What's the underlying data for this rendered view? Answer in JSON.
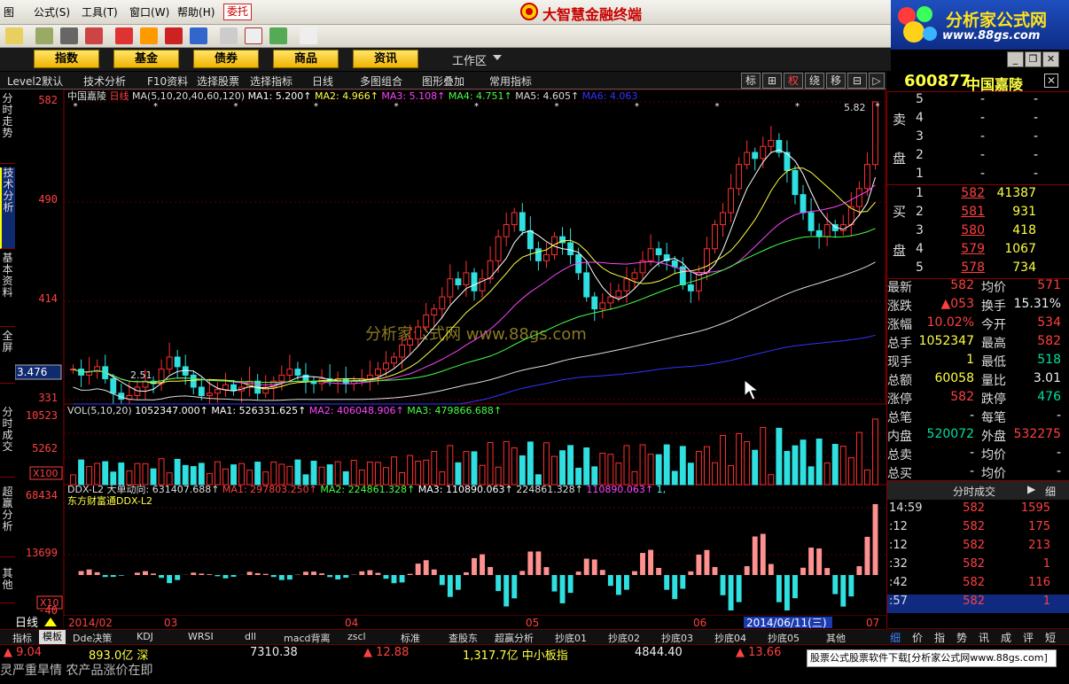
{
  "menubar": {
    "items": [
      "图",
      "公式",
      "工具",
      "窗口",
      "帮助"
    ],
    "item_keys": [
      "",
      "(S)",
      "(T)",
      "(W)",
      "(H)"
    ],
    "weituo": "委托",
    "title": "大智慧金融终端"
  },
  "brand": {
    "name": "分析家公式网",
    "url": "www.88gs.com"
  },
  "nav": {
    "buttons": [
      "指数",
      "基金",
      "债券",
      "商品",
      "资讯"
    ],
    "workarea": "工作区"
  },
  "subbar": {
    "items": [
      "Level2默认",
      "技术分析",
      "F10资料",
      "选择股票",
      "选择指标",
      "日线",
      "多图组合",
      "图形叠加",
      "常用指标"
    ],
    "buttons": [
      "标",
      "⊞",
      "权",
      "绕",
      "移",
      "⊟",
      "▷"
    ]
  },
  "left_tabs": [
    "分时走势",
    "技术分析",
    "基本资料",
    "全屏",
    "分时成交",
    "超赢分析",
    "其他"
  ],
  "stock": {
    "code": "600877",
    "name": "中国嘉陵"
  },
  "chart": {
    "header": [
      {
        "t": "中国嘉陵 ",
        "c": "#ddd"
      },
      {
        "t": "日线",
        "c": "#ff4040"
      },
      {
        "t": " MA(5,10,20,40,60,120) ",
        "c": "#ddd"
      },
      {
        "t": "MA1: 5.200↑",
        "c": "#fff"
      },
      {
        "t": " MA2: 4.966↑",
        "c": "#ffff44"
      },
      {
        "t": " MA3: 5.108↑",
        "c": "#ff44ff"
      },
      {
        "t": " MA4: 4.751↑",
        "c": "#44ff44"
      },
      {
        "t": " MA5: 4.605↑",
        "c": "#ddd"
      },
      {
        "t": " MA6: 4.063",
        "c": "#3333ff"
      }
    ],
    "price_labels": [
      "582",
      "490",
      "414",
      "331"
    ],
    "cursor_value": "3.476",
    "high_label": "5.82",
    "low_label": "2.51",
    "vol_header": [
      {
        "t": "VOL(5,10,20) ",
        "c": "#ddd"
      },
      {
        "t": "1052347.000↑",
        "c": "#fff"
      },
      {
        "t": "  MA1: 526331.625↑",
        "c": "#fff"
      },
      {
        "t": "  MA2: 406048.906↑",
        "c": "#ff44ff"
      },
      {
        "t": "  MA3: 479866.688↑",
        "c": "#44ff44"
      }
    ],
    "vol_labels": [
      "10523",
      "5262"
    ],
    "vol_unit": "X100",
    "ddx_header": [
      {
        "t": "DDX-L2  大单动向: 631407.688↑",
        "c": "#ddd"
      },
      {
        "t": "  MA1: 297803.250↑",
        "c": "#ff4040"
      },
      {
        "t": "  MA2: 224861.328↑",
        "c": "#44ff44"
      },
      {
        "t": "  MA3: 110890.063↑",
        "c": "#fff"
      },
      {
        "t": "  224861.328↑",
        "c": "#ddd"
      },
      {
        "t": "  110890.063↑",
        "c": "#ff44ff"
      },
      {
        "t": "  1,",
        "c": "#44ffff"
      }
    ],
    "ddx_subtitle": "东方财富通DDX-L2",
    "ddx_labels": [
      "68434",
      "13699",
      "-40"
    ],
    "ddx_unit": "X10",
    "dates": [
      "2014/02",
      "03",
      "04",
      "05",
      "06",
      "07"
    ],
    "date_selected": "2014/06/11(三)",
    "watermark": "分析家公式网 www.88gs.com",
    "period_label": "日线"
  },
  "chart_data": {
    "type": "candlestick",
    "ylim": [
      3.31,
      5.82
    ],
    "close": [
      3.6,
      3.55,
      3.58,
      3.62,
      3.52,
      3.4,
      3.35,
      3.38,
      3.45,
      3.5,
      3.48,
      3.6,
      3.7,
      3.62,
      3.55,
      3.45,
      3.38,
      3.4,
      3.43,
      3.47,
      3.42,
      3.45,
      3.5,
      3.4,
      3.45,
      3.5,
      3.55,
      3.6,
      3.55,
      3.5,
      3.48,
      3.52,
      3.5,
      3.52,
      3.48,
      3.5,
      3.52,
      3.55,
      3.6,
      3.65,
      3.7,
      3.8,
      3.85,
      3.95,
      4.05,
      4.1,
      4.2,
      4.35,
      4.3,
      4.4,
      4.25,
      4.35,
      4.5,
      4.7,
      4.8,
      4.9,
      4.75,
      4.6,
      4.5,
      4.55,
      4.7,
      4.65,
      4.55,
      4.4,
      4.2,
      4.1,
      4.15,
      4.2,
      4.25,
      4.35,
      4.4,
      4.5,
      4.6,
      4.55,
      4.5,
      4.45,
      4.3,
      4.25,
      4.4,
      4.6,
      4.8,
      4.9,
      5.1,
      5.3,
      5.4,
      5.35,
      5.45,
      5.5,
      5.4,
      5.25,
      5.05,
      4.9,
      4.75,
      4.7,
      4.8,
      4.75,
      4.8,
      4.95,
      5.1,
      5.3,
      5.82
    ],
    "ma_names": [
      "MA1",
      "MA2",
      "MA3",
      "MA4",
      "MA5",
      "MA6"
    ],
    "ma_colors": [
      "#ffffff",
      "#ffff44",
      "#ff44ff",
      "#44ff44",
      "#dddddd",
      "#3333ff"
    ],
    "vol_max": 10523,
    "ddx_max": 68434,
    "ddx_min": -40
  },
  "quote": {
    "sell_label": "卖盘",
    "buy_label": "买盘",
    "sell": [
      [
        "5",
        "-",
        "-"
      ],
      [
        "4",
        "-",
        "-"
      ],
      [
        "3",
        "-",
        "-"
      ],
      [
        "2",
        "-",
        "-"
      ],
      [
        "1",
        "-",
        "-"
      ]
    ],
    "buy": [
      [
        "1",
        "582",
        "41387"
      ],
      [
        "2",
        "581",
        "931"
      ],
      [
        "3",
        "580",
        "418"
      ],
      [
        "4",
        "579",
        "1067"
      ],
      [
        "5",
        "578",
        "734"
      ]
    ],
    "stats": [
      [
        "最新",
        "582",
        "red",
        "均价",
        "571",
        "red"
      ],
      [
        "涨跌",
        "▲053",
        "red",
        "换手",
        "15.31%",
        "wht"
      ],
      [
        "涨幅",
        "10.02%",
        "red",
        "今开",
        "534",
        "red"
      ],
      [
        "总手",
        "1052347",
        "yel",
        "最高",
        "582",
        "red"
      ],
      [
        "现手",
        "1",
        "yel",
        "最低",
        "518",
        "grn"
      ],
      [
        "总额",
        "60058",
        "yel",
        "量比",
        "3.01",
        "wht"
      ],
      [
        "涨停",
        "582",
        "red",
        "跌停",
        "476",
        "grn"
      ],
      [
        "总笔",
        "-",
        "wht",
        "每笔",
        "-",
        "wht"
      ],
      [
        "内盘",
        "520072",
        "grn",
        "外盘",
        "532275",
        "red"
      ],
      [
        "总卖",
        "-",
        "wht",
        "均价",
        "-",
        "wht"
      ],
      [
        "总买",
        "-",
        "wht",
        "均价",
        "-",
        "wht"
      ]
    ],
    "ticks_title": "分时成交",
    "ticks_btn": "细",
    "ticks": [
      [
        "14:59",
        "582",
        "1595"
      ],
      [
        ":12",
        "582",
        "175"
      ],
      [
        ":12",
        "582",
        "213"
      ],
      [
        ":32",
        "582",
        "1"
      ],
      [
        ":42",
        "582",
        "116"
      ],
      [
        ":57",
        "582",
        "1"
      ]
    ]
  },
  "bottom_tabs": [
    "指标",
    "模板",
    "Dde决策",
    "KDJ",
    "WRSI",
    "dll",
    "macd背离",
    "zscl",
    "标准",
    "查股东",
    "超赢分析",
    "抄底01",
    "抄底02",
    "抄底03",
    "抄底04",
    "抄底05",
    "其他"
  ],
  "right_tabs": [
    "细",
    "价",
    "指",
    "势",
    "讯",
    "成",
    "评",
    "短"
  ],
  "ticker": [
    [
      "▲ 9.04",
      "red"
    ],
    [
      "893.0亿 深",
      "yel"
    ],
    [
      "7310.38",
      "wht"
    ],
    [
      "▲ 12.88",
      "red"
    ],
    [
      "1,317.7亿 中小板指",
      "yel"
    ],
    [
      "4844.40",
      "wht"
    ],
    [
      "▲ 13.66",
      "red"
    ]
  ],
  "marquee": "灵严重旱情 农产品涨价在即",
  "adbox": "股票公式股票软件下载[分析家公式网www.88gs.com]"
}
